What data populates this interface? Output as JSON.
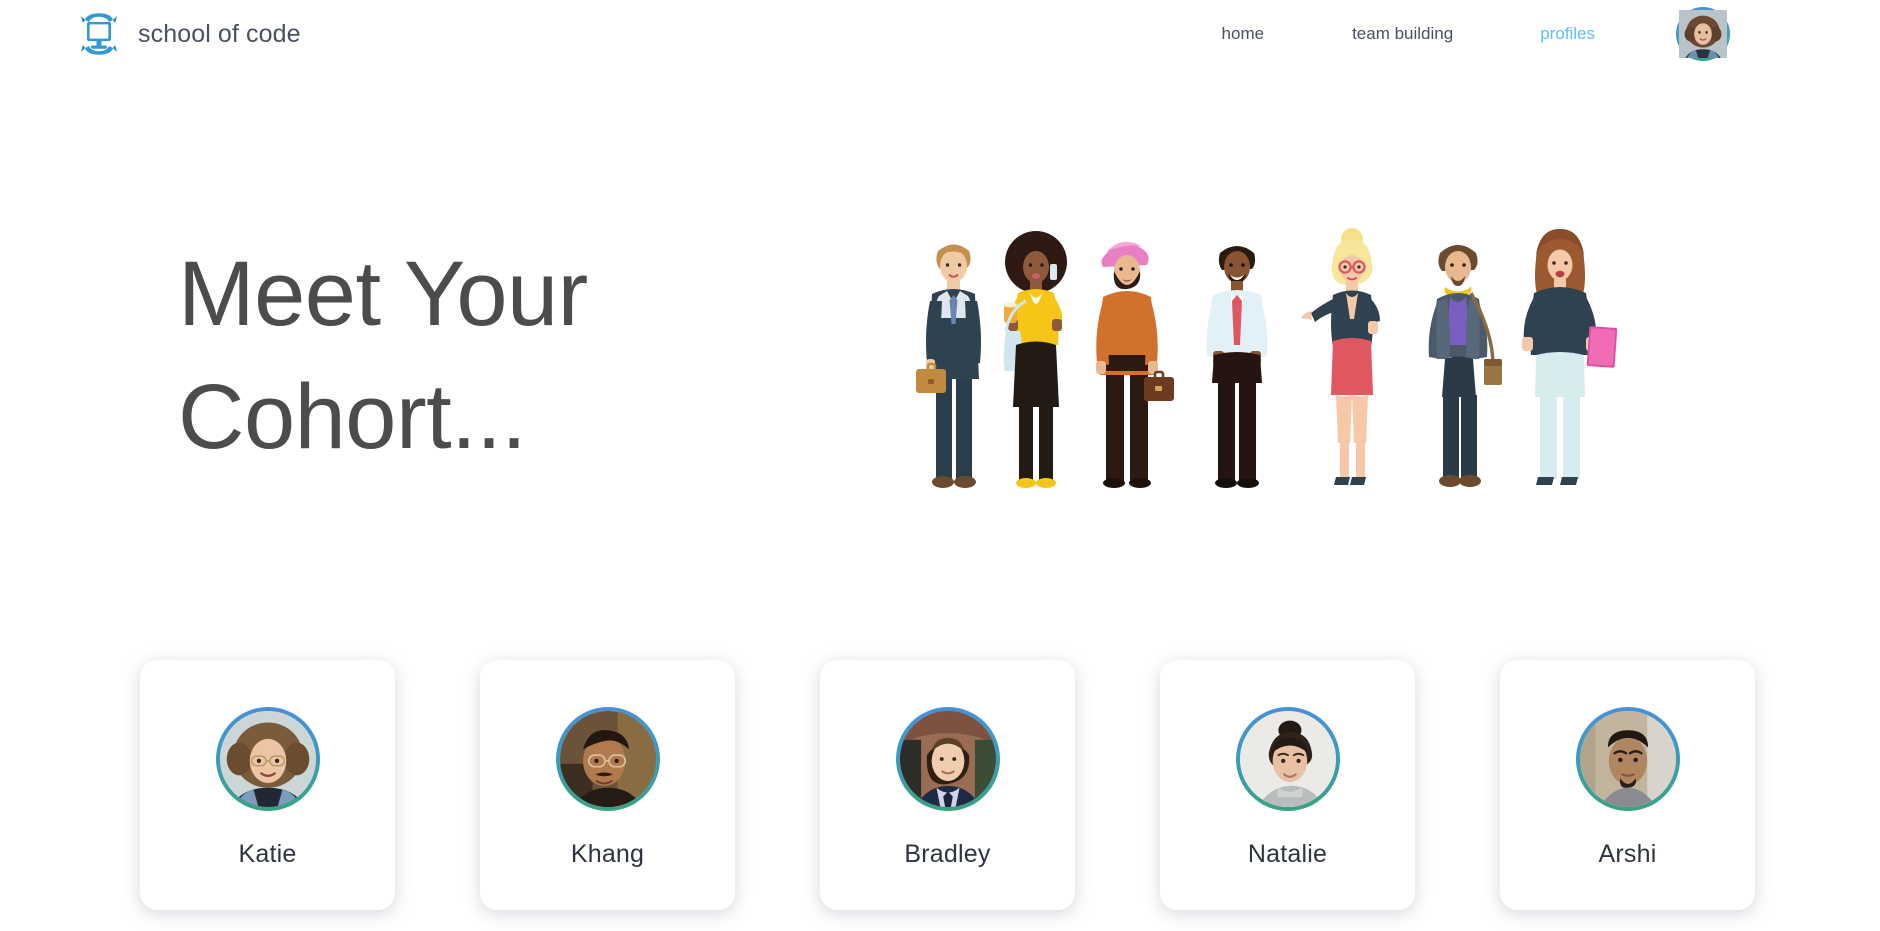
{
  "brand": {
    "name": "school of code",
    "logo_icon": "computer-monitor-ribbon-logo",
    "logo_color": "#2e9bd6"
  },
  "nav": {
    "items": [
      {
        "label": "home",
        "active": false
      },
      {
        "label": "team building",
        "active": false
      },
      {
        "label": "profiles",
        "active": true
      }
    ],
    "active_color": "#5ec2e8",
    "inactive_color": "#4a5160",
    "user_avatar": {
      "icon": "user-avatar",
      "alt": "curly haired woman portrait",
      "ring_gradient": [
        "#4a90d9",
        "#3aa57f"
      ]
    }
  },
  "hero": {
    "title_line_1": "Meet Your",
    "title_line_2": "Cohort...",
    "title_color": "#4c4c4c",
    "illustration": {
      "icon": "diverse-business-people-illustration",
      "people_count": 7,
      "alt": "flat illustration of seven diverse business people standing in a row"
    }
  },
  "profiles": {
    "cards": [
      {
        "name": "Katie",
        "avatar_icon": "avatar-katie"
      },
      {
        "name": "Khang",
        "avatar_icon": "avatar-khang"
      },
      {
        "name": "Bradley",
        "avatar_icon": "avatar-bradley"
      },
      {
        "name": "Natalie",
        "avatar_icon": "avatar-natalie"
      },
      {
        "name": "Arshi",
        "avatar_icon": "avatar-arshi"
      }
    ],
    "ring_gradient": [
      "#4a8fd8",
      "#38a37e"
    ],
    "card_background": "#ffffff",
    "name_color": "#2e3440"
  }
}
